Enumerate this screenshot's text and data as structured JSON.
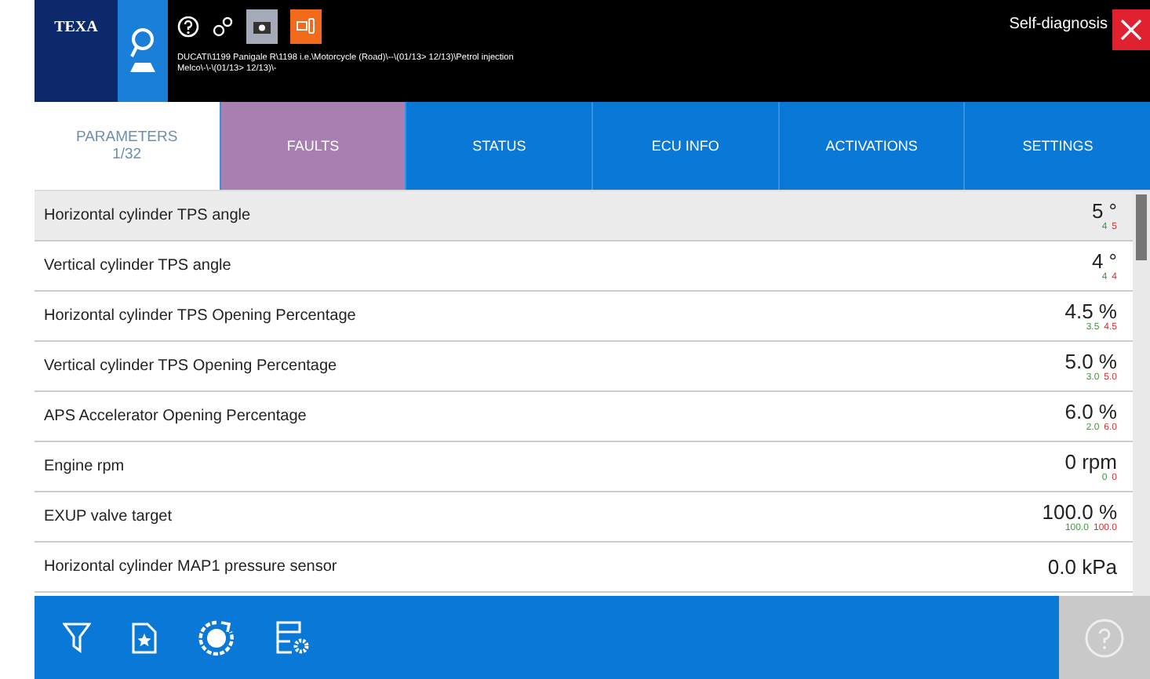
{
  "header": {
    "logo": "TEXA",
    "breadcrumb": "DUCATI\\1199 Panigale R\\1198 i.e.\\Motorcycle (Road)\\--\\(01/13> 12/13)\\Petrol injection Melco\\-\\-\\(01/13> 12/13)\\-",
    "title": "Self-diagnosis"
  },
  "tabs": [
    {
      "label": "PARAMETERS",
      "sub": "1/32",
      "selected": true
    },
    {
      "label": "FAULTS",
      "selected": false,
      "color": "#a77fb0"
    },
    {
      "label": "STATUS",
      "selected": false
    },
    {
      "label": "ECU INFO",
      "selected": false
    },
    {
      "label": "ACTIVATIONS",
      "selected": false
    },
    {
      "label": "SETTINGS",
      "selected": false
    }
  ],
  "parameters": [
    {
      "name": "Horizontal cylinder TPS angle",
      "value": "5 °",
      "min": "4",
      "max": "5",
      "selected": true
    },
    {
      "name": "Vertical cylinder TPS angle",
      "value": "4 °",
      "min": "4",
      "max": "4",
      "selected": false
    },
    {
      "name": "Horizontal cylinder TPS Opening Percentage",
      "value": "4.5 %",
      "min": "3.5",
      "max": "4.5",
      "selected": false
    },
    {
      "name": "Vertical cylinder TPS Opening Percentage",
      "value": "5.0 %",
      "min": "3.0",
      "max": "5.0",
      "selected": false
    },
    {
      "name": "APS Accelerator Opening Percentage",
      "value": "6.0 %",
      "min": "2.0",
      "max": "6.0",
      "selected": false
    },
    {
      "name": "Engine rpm",
      "value": "0 rpm",
      "min": "0",
      "max": "0",
      "selected": false
    },
    {
      "name": "EXUP valve target",
      "value": "100.0 %",
      "min": "100.0",
      "max": "100.0",
      "selected": false
    },
    {
      "name": "Horizontal cylinder MAP1 pressure sensor",
      "value": "0.0 kPa",
      "selected": false
    }
  ]
}
